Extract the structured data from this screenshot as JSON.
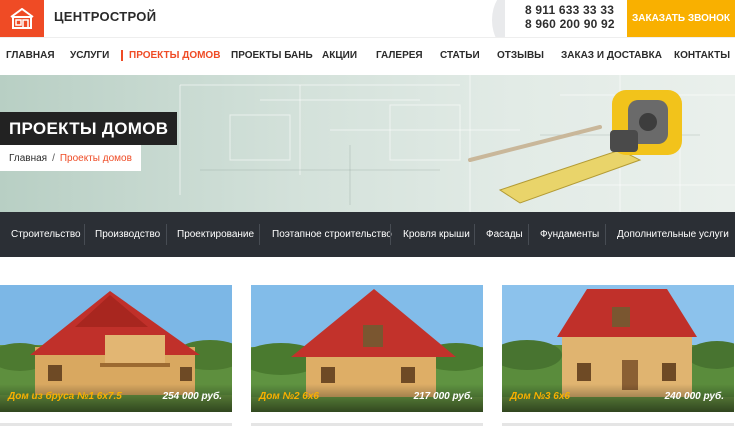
{
  "brand": {
    "name": "ЦЕНТРОСТРОЙ"
  },
  "contacts": {
    "phone1": "8 911 633 33 33",
    "phone2": "8 960 200 90 92"
  },
  "cta": {
    "label": "ЗАКАЗАТЬ ЗВОНОК"
  },
  "nav": [
    {
      "label": "ГЛАВНАЯ"
    },
    {
      "label": "УСЛУГИ"
    },
    {
      "label": "ПРОЕКТЫ ДОМОВ"
    },
    {
      "label": "ПРОЕКТЫ БАНЬ"
    },
    {
      "label": "АКЦИИ"
    },
    {
      "label": "ГАЛЕРЕЯ"
    },
    {
      "label": "СТАТЬИ"
    },
    {
      "label": "ОТЗЫВЫ"
    },
    {
      "label": "ЗАКАЗ И ДОСТАВКА"
    },
    {
      "label": "КОНТАКТЫ"
    }
  ],
  "hero": {
    "title": "ПРОЕКТЫ ДОМОВ",
    "breadcrumb": {
      "home": "Главная",
      "separator": "/",
      "current": "Проекты домов"
    }
  },
  "categories": [
    "Строительство",
    "Производство",
    "Проектирование",
    "Поэтапное строительство",
    "Кровля крыши",
    "Фасады",
    "Фундаменты",
    "Дополнительные услуги"
  ],
  "projects": [
    {
      "name": "Дом из бруса №1 6х7.5",
      "price": "254 000 руб."
    },
    {
      "name": "Дом №2 6х6",
      "price": "217 000 руб."
    },
    {
      "name": "Дом №3 6х6",
      "price": "240 000 руб."
    }
  ],
  "colors": {
    "accent": "#ef4b25",
    "cta": "#f9b000",
    "dark": "#2b2f35",
    "roof": "#c0302a",
    "wood": "#d9a860"
  },
  "icons": {
    "logo": "house-icon",
    "tape": "tape-measure-icon"
  }
}
